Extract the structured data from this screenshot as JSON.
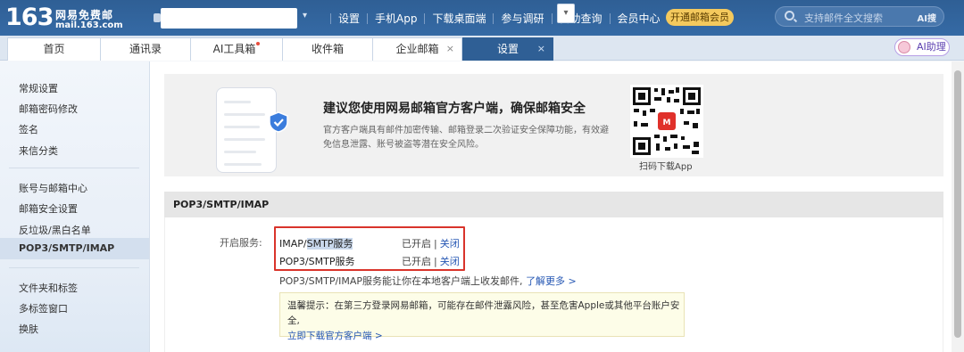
{
  "header": {
    "logo_num": "163",
    "logo_cn": "网易免费邮",
    "logo_en": "mail.163.com",
    "nav": [
      "设置",
      "手机App",
      "下载桌面端",
      "参与调研",
      "自助查询",
      "会员中心"
    ],
    "vip_button": "开通邮箱会员",
    "search_placeholder": "支持邮件全文搜索",
    "search_ai": "AI搜"
  },
  "tabs": {
    "home": "首页",
    "contacts": "通讯录",
    "ai_tools": "AI工具箱",
    "inbox": "收件箱",
    "enterprise": "企业邮箱",
    "settings": "设置",
    "ai_assistant": "AI助理"
  },
  "sidebar": {
    "group1": [
      "常规设置",
      "邮箱密码修改",
      "签名",
      "来信分类"
    ],
    "group2": [
      "账号与邮箱中心",
      "邮箱安全设置",
      "反垃圾/黑白名单",
      "POP3/SMTP/IMAP"
    ],
    "group3": [
      "文件夹和标签",
      "多标签窗口",
      "换肤"
    ]
  },
  "promo": {
    "title": "建议您使用网易邮箱官方客户端，确保邮箱安全",
    "desc": "官方客户端具有邮件加密传输、邮箱登录二次验证安全保障功能，有效避免信息泄露、账号被盗等潜在安全风险。",
    "qr_caption": "扫码下载App"
  },
  "section": {
    "title": "POP3/SMTP/IMAP",
    "open_label": "开启服务:",
    "services": [
      {
        "name_pre": "IMAP/",
        "name_hl": "SMTP服务",
        "status": "已开启",
        "action": "关闭"
      },
      {
        "name_pre": "POP3/SMTP服务",
        "name_hl": "",
        "status": "已开启",
        "action": "关闭"
      }
    ],
    "info": "POP3/SMTP/IMAP服务能让你在本地客户端上收发邮件,",
    "info_link": "了解更多 >",
    "tip_text": "温馨提示：在第三方登录网易邮箱，可能存在邮件泄露风险，甚至危害Apple或其他平台账户安全,",
    "tip_link": "立即下载官方客户端 >"
  },
  "colors": {
    "header_bg": "#2f5f95",
    "accent_red": "#d9342b",
    "link": "#2456b3",
    "vip": "#f4c95d"
  }
}
